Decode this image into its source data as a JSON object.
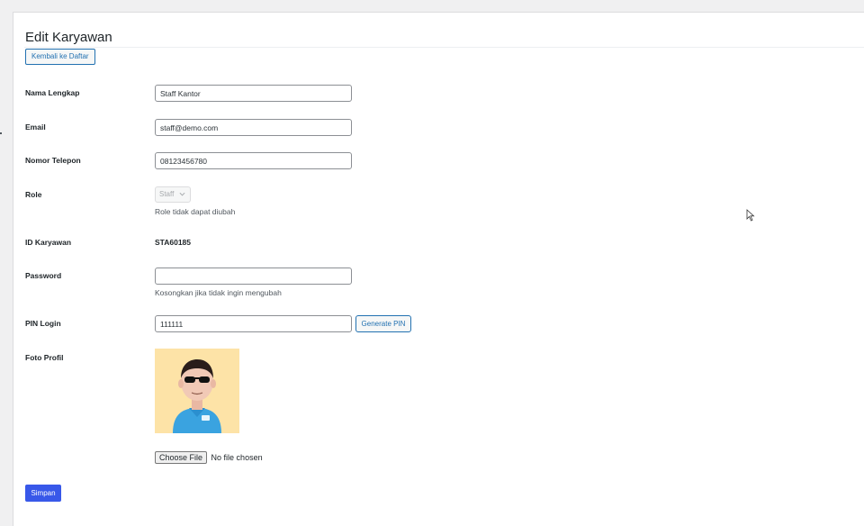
{
  "page": {
    "title": "Edit Karyawan",
    "back_label": "Kembali ke Daftar"
  },
  "form": {
    "nama_label": "Nama Lengkap",
    "nama_value": "Staff Kantor",
    "email_label": "Email",
    "email_value": "staff@demo.com",
    "telepon_label": "Nomor Telepon",
    "telepon_value": "08123456780",
    "role_label": "Role",
    "role_value": "Staff",
    "role_desc": "Role tidak dapat diubah",
    "id_label": "ID Karyawan",
    "id_value": "STA60185",
    "password_label": "Password",
    "password_value": "",
    "password_desc": "Kosongkan jika tidak ingin mengubah",
    "pin_label": "PIN Login",
    "pin_value": "111111",
    "pin_button": "Generate PIN",
    "foto_label": "Foto Profil",
    "file_button": "Choose File",
    "file_status": "No file chosen",
    "save_button": "Simpan"
  },
  "icons": {
    "select": "chevron-down-icon",
    "cursor": "mouse-cursor-icon",
    "avatar": "profile-avatar-image"
  },
  "colors": {
    "accent": "#2271b1",
    "primary_button": "#3858e9",
    "avatar_bg": "#fde3a7"
  }
}
